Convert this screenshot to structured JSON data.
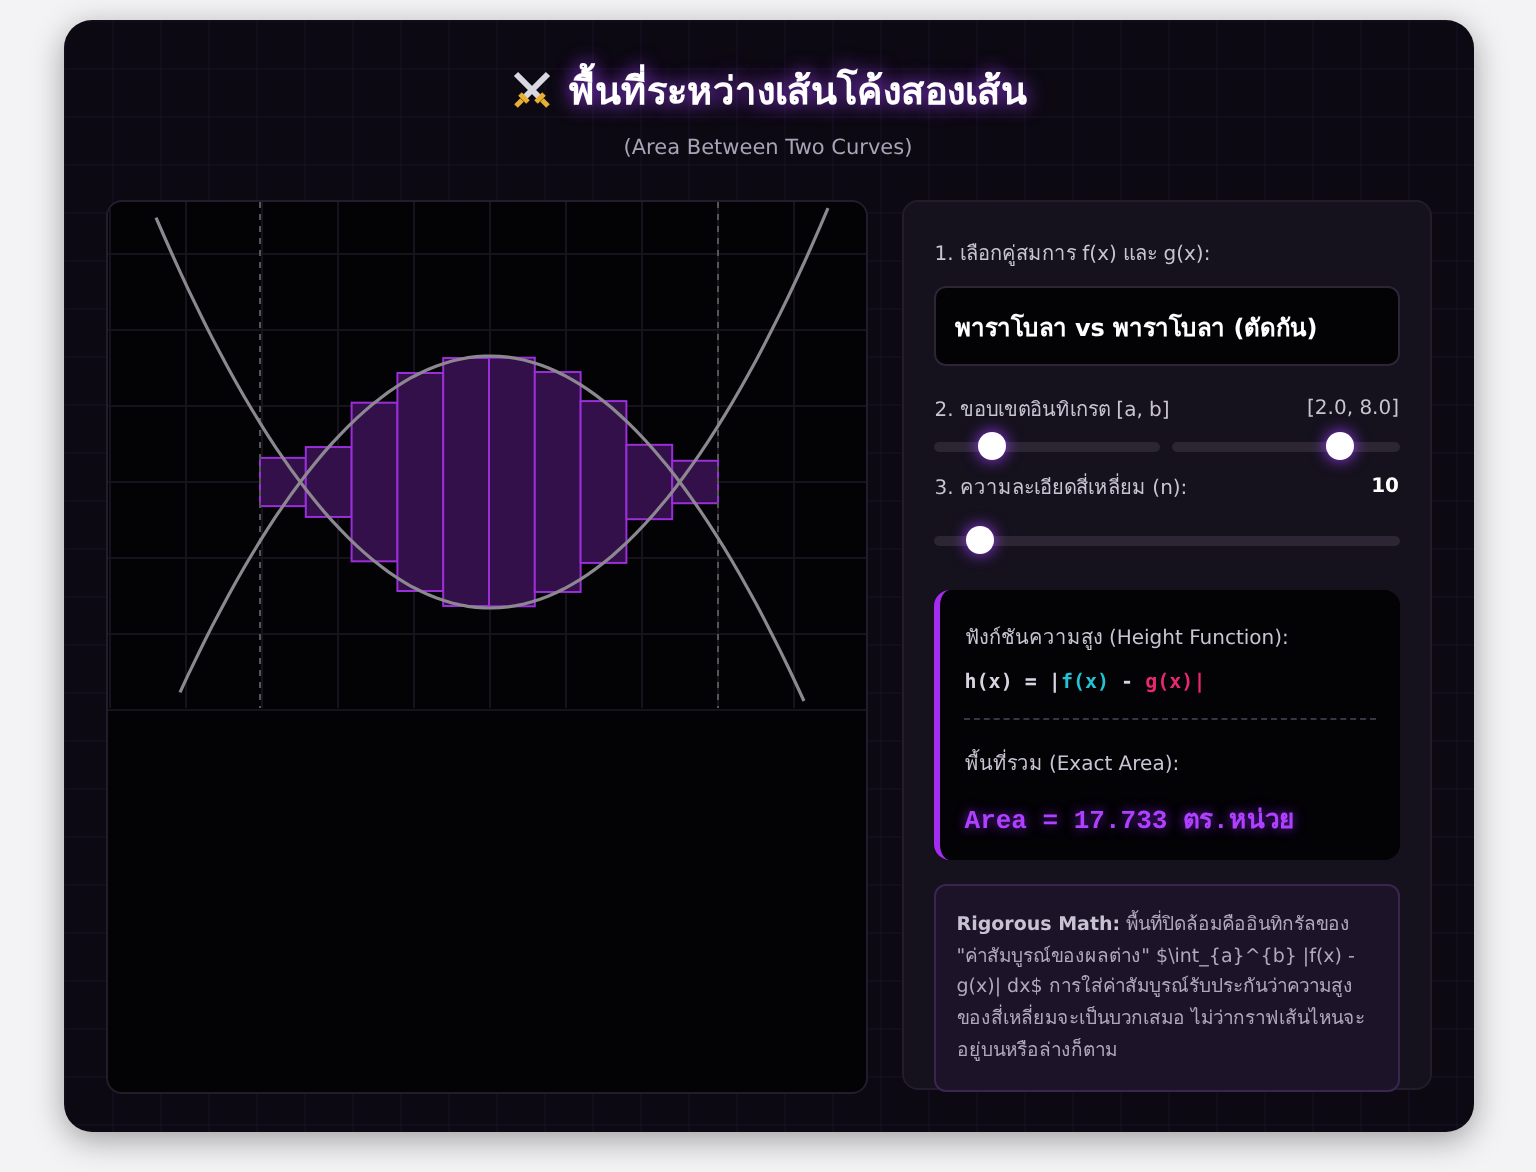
{
  "header": {
    "title": "พื้นที่ระหว่างเส้นโค้งสองเส้น",
    "subtitle": "(Area Between Two Curves)"
  },
  "controls": {
    "pair_label": "1. เลือกคู่สมการ f(x) และ g(x):",
    "pair_value": "พาราโบลา vs พาราโบลา (ตัดกัน)",
    "bounds_label": "2. ขอบเขตอินทิเกรต [a, b]",
    "bounds_value": "[2.0, 8.0]",
    "bounds": [
      {
        "level": 0.25
      },
      {
        "level": 0.74
      }
    ],
    "n_label": "3. ความละเอียดสี่เหลี่ยม (n):",
    "n_value": "10",
    "n_slider": {
      "level": 0.1
    }
  },
  "result": {
    "height_label": "ฟังก์ชันความสูง (Height Function):",
    "formula": [
      {
        "text": "h(x) = |",
        "color": "#d8d4e0"
      },
      {
        "text": "f(x)",
        "color": "#22c3d3"
      },
      {
        "text": " - ",
        "color": "#d8d4e0"
      },
      {
        "text": "g(x)",
        "color": "#e8286f"
      },
      {
        "text": "|",
        "color": "#e8286f"
      }
    ],
    "area_label": "พื้นที่รวม (Exact Area):",
    "area_value": "Area = 17.733 ตร.หน่วย"
  },
  "note": "**Rigorous Math:** พื้นที่ปิดล้อมคืออินทิกรัลของ \"ค่าสัมบูรณ์ของผลต่าง\" $\\int_{a}^{b} |f(x) - g(x)| dx$ การใส่ค่าสัมบูรณ์รับประกันว่าความสูงของสี่เหลี่ยมจะเป็นบวกเสมอ ไม่ว่ากราฟเส้นไหนจะอยู่บนหรือล่างก็ตาม"
}
